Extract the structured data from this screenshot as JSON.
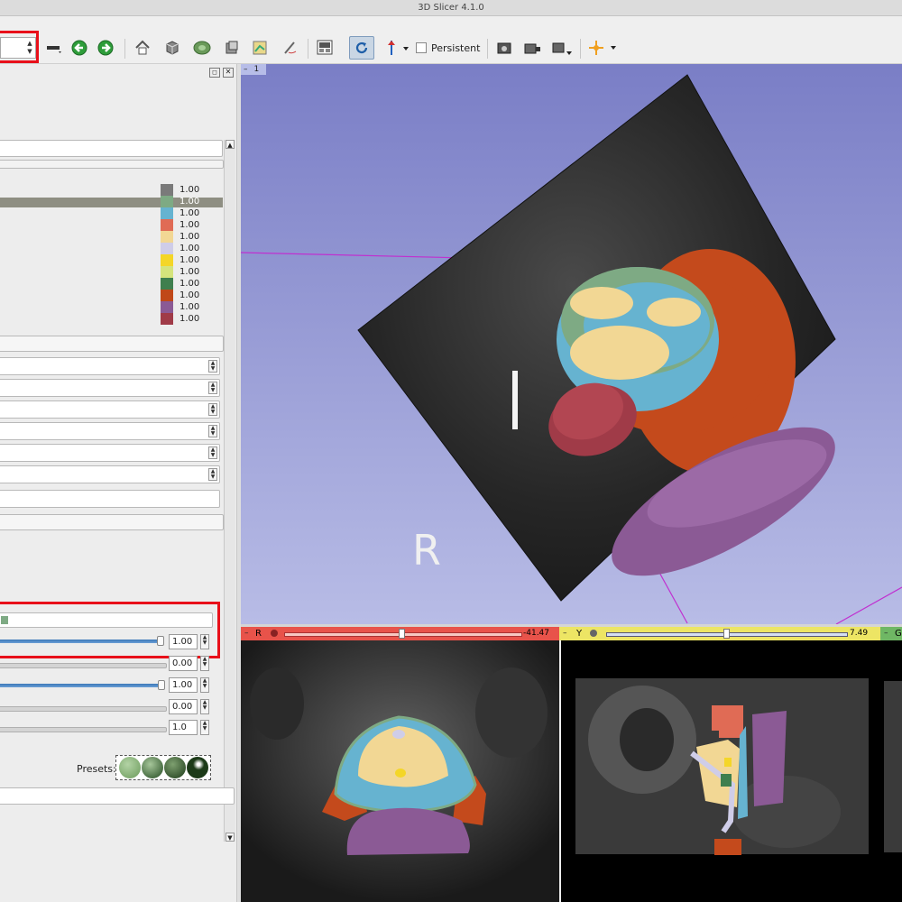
{
  "window": {
    "title": "3D Slicer 4.1.0"
  },
  "toolbar": {
    "persistent_label": "Persistent",
    "icons": [
      "layout-spinbox",
      "window-level-icon",
      "back-icon",
      "forward-icon",
      "home-icon",
      "data-icon",
      "models-icon",
      "volumes-icon",
      "editor-icon",
      "annotation-icon",
      "layout-icon",
      "reload-icon",
      "mouse-mode-icon",
      "screenshot-icon",
      "capture-icon",
      "capture2-icon",
      "crosshair-icon"
    ]
  },
  "left_panel": {
    "legend_values": [
      "1.00",
      "1.00",
      "1.00",
      "1.00",
      "1.00",
      "1.00",
      "1.00",
      "1.00",
      "1.00",
      "1.00",
      "1.00",
      "1.00"
    ],
    "legend_colors": [
      "#7a7a7a",
      "#7eaa84",
      "#66b3d0",
      "#e06b55",
      "#f2d794",
      "#cfcde8",
      "#f4d628",
      "#d5e47c",
      "#3f7f4e",
      "#c04818",
      "#8b5a95",
      "#a03b48"
    ],
    "opacity_value": "1.00",
    "ambient_value": "0.00",
    "diffuse_value": "1.00",
    "specular_value": "0.00",
    "power_value": "1.0",
    "presets_label": "Presets:"
  },
  "view3d": {
    "tab_label": "1",
    "orientation_label": "R"
  },
  "slices": {
    "red": {
      "label": "R",
      "offset": "-41.47"
    },
    "yellow": {
      "label": "Y",
      "offset": "7.49"
    },
    "green": {
      "label": "G"
    }
  }
}
